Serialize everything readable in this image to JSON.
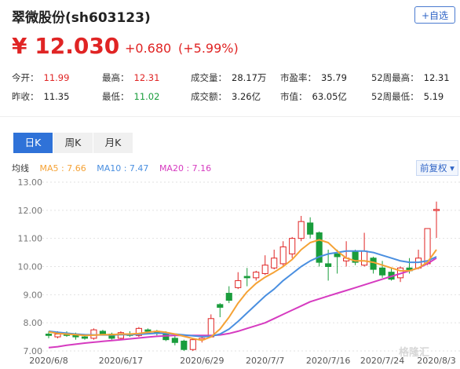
{
  "header": {
    "title": "翠微股份(sh603123)",
    "follow_label": "+自选"
  },
  "quote": {
    "price": "¥ 12.030",
    "change": "+0.680",
    "change_pct": "(+5.99%)"
  },
  "stats": [
    {
      "label": "今开",
      "value": "11.99",
      "color": "red"
    },
    {
      "label": "最高",
      "value": "12.31",
      "color": "red"
    },
    {
      "label": "成交量",
      "value": "28.17万",
      "color": ""
    },
    {
      "label": "市盈率",
      "value": "35.79",
      "color": ""
    },
    {
      "label": "52周最高",
      "value": "12.31",
      "color": ""
    },
    {
      "label": "昨收",
      "value": "11.35",
      "color": ""
    },
    {
      "label": "最低",
      "value": "11.02",
      "color": "green"
    },
    {
      "label": "成交额",
      "value": "3.26亿",
      "color": ""
    },
    {
      "label": "市值",
      "value": "63.05亿",
      "color": ""
    },
    {
      "label": "52周最低",
      "value": "5.19",
      "color": ""
    }
  ],
  "tabs": [
    {
      "label": "日K",
      "active": true
    },
    {
      "label": "周K",
      "active": false
    },
    {
      "label": "月K",
      "active": false
    }
  ],
  "legend": {
    "prefix": "均线",
    "ma5": "MA5 : 7.66",
    "ma10": "MA10 : 7.47",
    "ma20": "MA20 : 7.16"
  },
  "adjust_label": "前复权",
  "watermark": "格隆汇",
  "colors": {
    "up": "#e02424",
    "down": "#1a9d3c",
    "ma5": "#f5a235",
    "ma10": "#4a8fe0",
    "ma20": "#d63bc0",
    "accent": "#2f72d8"
  },
  "chart_data": {
    "type": "candlestick",
    "ylim": [
      7.0,
      13.0
    ],
    "y_ticks": [
      "13.00",
      "12.00",
      "11.00",
      "10.00",
      "9.00",
      "8.00",
      "7.00"
    ],
    "x_tick_labels": [
      {
        "index": 0,
        "label": "2020/6/8"
      },
      {
        "index": 8,
        "label": "2020/6/17"
      },
      {
        "index": 17,
        "label": "2020/6/29"
      },
      {
        "index": 24,
        "label": "2020/7/7"
      },
      {
        "index": 31,
        "label": "2020/7/16"
      },
      {
        "index": 37,
        "label": "2020/7/24"
      },
      {
        "index": 43,
        "label": "2020/8/3"
      }
    ],
    "candles": [
      {
        "o": 7.6,
        "c": 7.55,
        "h": 7.7,
        "l": 7.45
      },
      {
        "o": 7.5,
        "c": 7.6,
        "h": 7.7,
        "l": 7.45
      },
      {
        "o": 7.6,
        "c": 7.55,
        "h": 7.7,
        "l": 7.5
      },
      {
        "o": 7.55,
        "c": 7.5,
        "h": 7.65,
        "l": 7.4
      },
      {
        "o": 7.5,
        "c": 7.45,
        "h": 7.6,
        "l": 7.4
      },
      {
        "o": 7.45,
        "c": 7.75,
        "h": 7.8,
        "l": 7.4
      },
      {
        "o": 7.7,
        "c": 7.6,
        "h": 7.75,
        "l": 7.55
      },
      {
        "o": 7.6,
        "c": 7.45,
        "h": 7.65,
        "l": 7.4
      },
      {
        "o": 7.45,
        "c": 7.65,
        "h": 7.7,
        "l": 7.4
      },
      {
        "o": 7.6,
        "c": 7.55,
        "h": 7.7,
        "l": 7.5
      },
      {
        "o": 7.55,
        "c": 7.8,
        "h": 7.85,
        "l": 7.5
      },
      {
        "o": 7.75,
        "c": 7.7,
        "h": 7.8,
        "l": 7.6
      },
      {
        "o": 7.7,
        "c": 7.65,
        "h": 7.75,
        "l": 7.55
      },
      {
        "o": 7.65,
        "c": 7.4,
        "h": 7.7,
        "l": 7.35
      },
      {
        "o": 7.45,
        "c": 7.3,
        "h": 7.55,
        "l": 7.2
      },
      {
        "o": 7.35,
        "c": 7.05,
        "h": 7.4,
        "l": 7.0
      },
      {
        "o": 7.05,
        "c": 7.4,
        "h": 7.45,
        "l": 7.0
      },
      {
        "o": 7.4,
        "c": 7.45,
        "h": 7.5,
        "l": 7.3
      },
      {
        "o": 7.5,
        "c": 8.15,
        "h": 8.3,
        "l": 7.5
      },
      {
        "o": 8.65,
        "c": 8.55,
        "h": 8.7,
        "l": 8.2
      },
      {
        "o": 9.05,
        "c": 8.8,
        "h": 9.3,
        "l": 8.7
      },
      {
        "o": 9.25,
        "c": 9.5,
        "h": 9.8,
        "l": 9.2
      },
      {
        "o": 9.65,
        "c": 9.6,
        "h": 9.95,
        "l": 9.3
      },
      {
        "o": 9.6,
        "c": 9.8,
        "h": 9.85,
        "l": 9.5
      },
      {
        "o": 9.75,
        "c": 10.05,
        "h": 10.4,
        "l": 9.7
      },
      {
        "o": 9.95,
        "c": 10.3,
        "h": 10.6,
        "l": 9.9
      },
      {
        "o": 10.1,
        "c": 10.7,
        "h": 10.9,
        "l": 10.0
      },
      {
        "o": 10.45,
        "c": 11.0,
        "h": 11.05,
        "l": 10.3
      },
      {
        "o": 11.0,
        "c": 11.6,
        "h": 11.8,
        "l": 10.9
      },
      {
        "o": 11.55,
        "c": 11.15,
        "h": 11.75,
        "l": 11.0
      },
      {
        "o": 11.2,
        "c": 10.15,
        "h": 11.25,
        "l": 10.0
      },
      {
        "o": 10.1,
        "c": 10.0,
        "h": 10.6,
        "l": 9.5
      },
      {
        "o": 10.45,
        "c": 10.35,
        "h": 10.6,
        "l": 9.75
      },
      {
        "o": 10.2,
        "c": 10.3,
        "h": 10.9,
        "l": 10.0
      },
      {
        "o": 10.55,
        "c": 10.15,
        "h": 10.6,
        "l": 10.05
      },
      {
        "o": 10.05,
        "c": 10.55,
        "h": 11.2,
        "l": 10.0
      },
      {
        "o": 10.3,
        "c": 9.9,
        "h": 10.35,
        "l": 9.75
      },
      {
        "o": 9.95,
        "c": 9.7,
        "h": 10.2,
        "l": 9.6
      },
      {
        "o": 9.8,
        "c": 9.55,
        "h": 9.95,
        "l": 9.5
      },
      {
        "o": 9.6,
        "c": 9.95,
        "h": 10.0,
        "l": 9.45
      },
      {
        "o": 9.95,
        "c": 9.85,
        "h": 10.3,
        "l": 9.75
      },
      {
        "o": 9.95,
        "c": 10.3,
        "h": 10.6,
        "l": 9.9
      },
      {
        "o": 10.1,
        "c": 11.35,
        "h": 11.35,
        "l": 10.05
      },
      {
        "o": 11.99,
        "c": 12.03,
        "h": 12.31,
        "l": 11.02
      }
    ],
    "ma5": [
      7.68,
      7.62,
      7.6,
      7.58,
      7.55,
      7.56,
      7.58,
      7.58,
      7.6,
      7.6,
      7.62,
      7.66,
      7.7,
      7.66,
      7.6,
      7.52,
      7.44,
      7.38,
      7.5,
      7.78,
      8.2,
      8.7,
      9.1,
      9.4,
      9.62,
      9.8,
      10.0,
      10.25,
      10.6,
      10.85,
      10.95,
      10.85,
      10.55,
      10.3,
      10.2,
      10.2,
      10.15,
      10.05,
      9.95,
      9.85,
      9.85,
      9.95,
      10.15,
      10.6
    ],
    "ma10": [
      7.7,
      7.66,
      7.63,
      7.6,
      7.58,
      7.57,
      7.57,
      7.57,
      7.58,
      7.58,
      7.59,
      7.61,
      7.63,
      7.62,
      7.6,
      7.57,
      7.54,
      7.51,
      7.52,
      7.6,
      7.78,
      8.05,
      8.35,
      8.65,
      8.95,
      9.2,
      9.5,
      9.75,
      10.0,
      10.2,
      10.35,
      10.45,
      10.5,
      10.55,
      10.55,
      10.55,
      10.5,
      10.4,
      10.3,
      10.2,
      10.15,
      10.15,
      10.2,
      10.35
    ],
    "ma20": [
      7.12,
      7.15,
      7.2,
      7.24,
      7.28,
      7.31,
      7.34,
      7.37,
      7.4,
      7.43,
      7.46,
      7.49,
      7.52,
      7.54,
      7.55,
      7.55,
      7.55,
      7.55,
      7.55,
      7.57,
      7.62,
      7.7,
      7.8,
      7.9,
      8.0,
      8.15,
      8.3,
      8.45,
      8.6,
      8.75,
      8.85,
      8.95,
      9.05,
      9.15,
      9.25,
      9.35,
      9.45,
      9.55,
      9.65,
      9.75,
      9.85,
      9.95,
      10.1,
      10.3
    ]
  }
}
